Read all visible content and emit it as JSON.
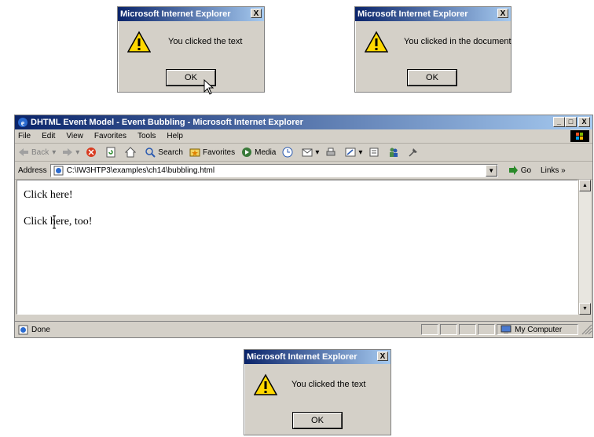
{
  "dialogs": [
    {
      "title": "Microsoft Internet Explorer",
      "close": "X",
      "message": "You clicked the text",
      "ok_label": "OK"
    },
    {
      "title": "Microsoft Internet Explorer",
      "close": "X",
      "message": "You clicked in the document",
      "ok_label": "OK"
    },
    {
      "title": "Microsoft Internet Explorer",
      "close": "X",
      "message": "You clicked the text",
      "ok_label": "OK"
    }
  ],
  "browser": {
    "title": "DHTML Event Model - Event Bubbling - Microsoft Internet Explorer",
    "window_buttons": [
      "_",
      "□",
      "X"
    ],
    "menu": [
      "File",
      "Edit",
      "View",
      "Favorites",
      "Tools",
      "Help"
    ],
    "toolbar": {
      "back": "Back",
      "search": "Search",
      "favorites": "Favorites",
      "media": "Media"
    },
    "address_label": "Address",
    "address_value": "C:\\IW3HTP3\\examples\\ch14\\bubbling.html",
    "go_label": "Go",
    "links_label": "Links »",
    "content": {
      "line1": "Click here!",
      "line2": "Click here, too!"
    },
    "status": {
      "text": "Done",
      "zone": "My Computer"
    }
  },
  "colors": {
    "titlebar_start": "#0a246a",
    "titlebar_end": "#a6caf0",
    "chrome": "#d4d0c8",
    "warning": "#ffd800"
  },
  "icons": [
    "warning-icon",
    "ie-icon",
    "back-icon",
    "forward-icon",
    "stop-icon",
    "refresh-icon",
    "home-icon",
    "search-icon",
    "favorites-icon",
    "media-icon",
    "history-icon",
    "mail-icon",
    "print-icon",
    "edit-icon",
    "discuss-icon",
    "messenger-icon",
    "page-icon",
    "go-icon",
    "computer-icon",
    "cursor-icon"
  ]
}
